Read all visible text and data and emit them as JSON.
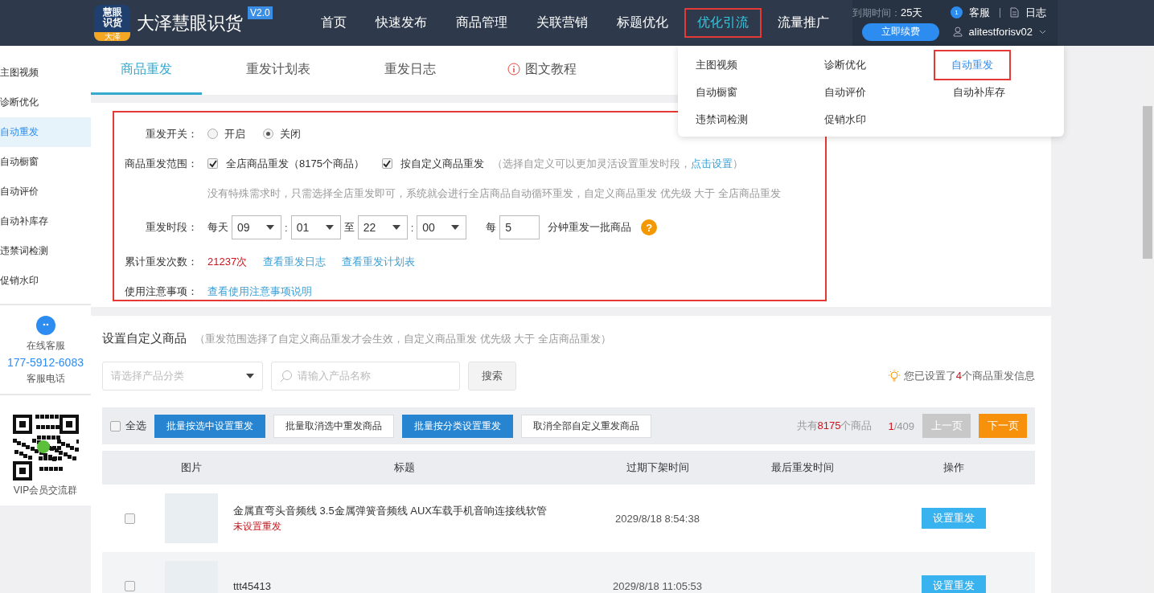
{
  "header": {
    "logo": {
      "line1": "慧眼",
      "line2": "识货",
      "tag": "大泽"
    },
    "brand": "大泽慧眼识货",
    "version": "V2.0",
    "nav": [
      {
        "label": "首页",
        "selected": false
      },
      {
        "label": "快速发布",
        "selected": false
      },
      {
        "label": "商品管理",
        "selected": false
      },
      {
        "label": "关联营销",
        "selected": false
      },
      {
        "label": "标题优化",
        "selected": false
      },
      {
        "label": "优化引流",
        "selected": true
      },
      {
        "label": "流量推广",
        "selected": false
      }
    ],
    "account": {
      "expiry_label": "到期时间：",
      "expiry_value": "25天",
      "renew": "立即续费",
      "service": "客服",
      "service_badge": "1",
      "log": "日志",
      "user": "alitestforisv02"
    }
  },
  "dropdown": [
    {
      "label": "主图视频",
      "selected": false
    },
    {
      "label": "诊断优化",
      "selected": false
    },
    {
      "label": "自动重发",
      "selected": true
    },
    {
      "label": "自动橱窗",
      "selected": false
    },
    {
      "label": "自动评价",
      "selected": false
    },
    {
      "label": "自动补库存",
      "selected": false
    },
    {
      "label": "违禁词检测",
      "selected": false
    },
    {
      "label": "促销水印",
      "selected": false
    }
  ],
  "sidebar": {
    "items": [
      {
        "label": "主图视频",
        "selected": false
      },
      {
        "label": "诊断优化",
        "selected": false
      },
      {
        "label": "自动重发",
        "selected": true
      },
      {
        "label": "自动橱窗",
        "selected": false
      },
      {
        "label": "自动评价",
        "selected": false
      },
      {
        "label": "自动补库存",
        "selected": false
      },
      {
        "label": "违禁词检测",
        "selected": false
      },
      {
        "label": "促销水印",
        "selected": false
      }
    ],
    "service_label": "在线客服",
    "phone": "177-5912-6083",
    "phone_label": "客服电话",
    "qr_label": "VIP会员交流群"
  },
  "tabs": [
    {
      "label": "商品重发",
      "selected": true,
      "kind": "plain"
    },
    {
      "label": "重发计划表",
      "selected": false,
      "kind": "plain"
    },
    {
      "label": "重发日志",
      "selected": false,
      "kind": "plain"
    },
    {
      "label": "图文教程",
      "selected": false,
      "kind": "info"
    }
  ],
  "settings": {
    "switch": {
      "label": "重发开关：",
      "options": [
        {
          "label": "开启",
          "selected": false
        },
        {
          "label": "关闭",
          "selected": true
        }
      ]
    },
    "scope": {
      "label": "商品重发范围：",
      "options": [
        {
          "label": "全店商品重发（8175个商品）",
          "checked": true
        },
        {
          "label": "按自定义商品重发",
          "checked": true,
          "note": "（选择自定义可以更加灵活设置重发时段，",
          "link": "点击设置",
          "note_end": "）"
        }
      ],
      "hint": "没有特殊需求时，只需选择全店重发即可，系统就会进行全店商品自动循环重发，自定义商品重发 优先级 大于 全店商品重发"
    },
    "schedule": {
      "label": "重发时段：",
      "prefix": "每天",
      "start_hour": "09",
      "start_minute": "01",
      "separator": ":",
      "to": "至",
      "end_hour": "22",
      "end_minute": "00",
      "every": "每",
      "interval": "5",
      "suffix": "分钟重发一批商品",
      "help": "?"
    },
    "stats": {
      "label": "累计重发次数：",
      "count": "21237次",
      "links": [
        "查看重发日志",
        "查看重发计划表"
      ]
    },
    "notes": {
      "label": "使用注意事项：",
      "link": "查看使用注意事项说明"
    }
  },
  "custom": {
    "title": "设置自定义商品",
    "note": "（重发范围选择了自定义商品重发才会生效，自定义商品重发 优先级 大于 全店商品重发）",
    "category_placeholder": "请选择产品分类",
    "search_placeholder": "请输入产品名称",
    "search_button": "搜索",
    "info_prefix": "您已设置了",
    "info_count": "4",
    "info_suffix": "个商品重发信息",
    "select_all": {
      "label": "全选",
      "checked": false
    },
    "buttons": [
      {
        "label": "批量按选中设置重发",
        "kind": "primary"
      },
      {
        "label": "批量取消选中重发商品",
        "kind": "default"
      },
      {
        "label": "批量按分类设置重发",
        "kind": "primary"
      },
      {
        "label": "取消全部自定义重发商品",
        "kind": "default"
      }
    ],
    "total_prefix": "共有",
    "total_count": "8175",
    "total_suffix": "个商品",
    "page_current": "1",
    "page_total": "/409",
    "prev": {
      "label": "上一页",
      "disabled": true
    },
    "next": {
      "label": "下一页",
      "disabled": false
    }
  },
  "table": {
    "columns": [
      "图片",
      "标题",
      "过期下架时间",
      "最后重发时间",
      "操作"
    ],
    "rows": [
      {
        "checked": false,
        "title": "金属直弯头音频线 3.5金属弹簧音频线 AUX车载手机音响连接线软管",
        "status": "未设置重发",
        "expire": "2029/8/18 8:54:38",
        "action": "设置重发"
      },
      {
        "checked": false,
        "title": "ttt45413",
        "expire": "2029/8/18 11:05:53",
        "action": "设置重发"
      }
    ]
  }
}
